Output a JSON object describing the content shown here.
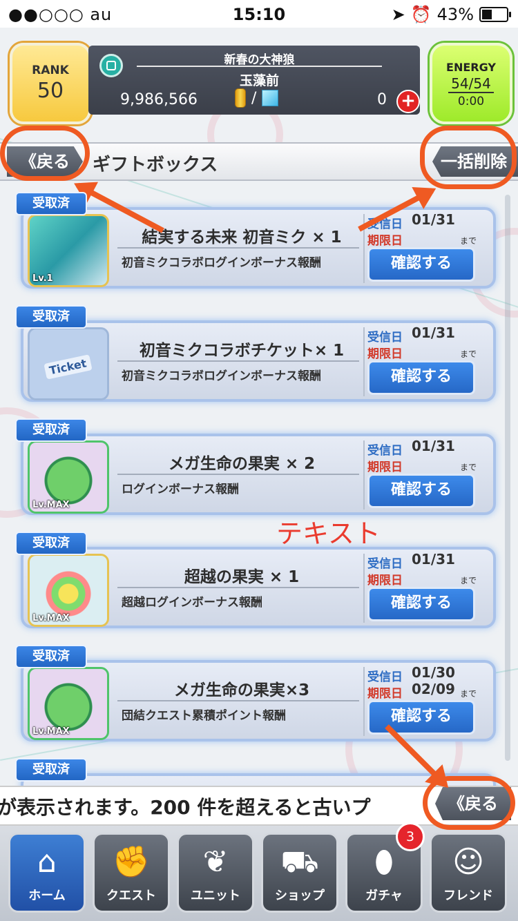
{
  "status_bar": {
    "carrier": "●●○○○ au",
    "time": "15:10",
    "battery": "43%"
  },
  "header": {
    "rank_label": "RANK",
    "rank_value": "50",
    "player_title": "新春の大神狼",
    "player_name": "玉藻前",
    "coins": "9,986,566",
    "currency_separator": "/",
    "gems": "0",
    "energy_label": "ENERGY",
    "energy_value": "54/54",
    "energy_timer": "0:00"
  },
  "titlebar": {
    "back_label": "《戻る",
    "title": "ギフトボックス",
    "delete_all_label": "一括削除"
  },
  "items": [
    {
      "tag": "受取済",
      "name": "結実する未来 初音ミク × 1",
      "desc": "初音ミクコラボログインボーナス報酬",
      "recv_label": "受信日",
      "recv_date": "01/31",
      "exp_label": "期限日",
      "exp_date": "",
      "until": "まで",
      "button": "確認する",
      "thumb_level": "Lv.1"
    },
    {
      "tag": "受取済",
      "name": "初音ミクコラボチケット× 1",
      "desc": "初音ミクコラボログインボーナス報酬",
      "recv_label": "受信日",
      "recv_date": "01/31",
      "exp_label": "期限日",
      "exp_date": "",
      "until": "まで",
      "button": "確認する",
      "thumb_level": "Ticket"
    },
    {
      "tag": "受取済",
      "name": "メガ生命の果実 × 2",
      "desc": "ログインボーナス報酬",
      "recv_label": "受信日",
      "recv_date": "01/31",
      "exp_label": "期限日",
      "exp_date": "",
      "until": "まで",
      "button": "確認する",
      "thumb_level": "Lv.MAX"
    },
    {
      "tag": "受取済",
      "name": "超越の果実 × 1",
      "desc": "超越ログインボーナス報酬",
      "recv_label": "受信日",
      "recv_date": "01/31",
      "exp_label": "期限日",
      "exp_date": "",
      "until": "まで",
      "button": "確認する",
      "thumb_level": "Lv.MAX"
    },
    {
      "tag": "受取済",
      "name": "メガ生命の果実×3",
      "desc": "団結クエスト累積ポイント報酬",
      "recv_label": "受信日",
      "recv_date": "01/30",
      "exp_label": "期限日",
      "exp_date": "02/09",
      "until": "まで",
      "button": "確認する",
      "thumb_level": "Lv.MAX"
    },
    {
      "tag": "受取済"
    }
  ],
  "annotation_text": "テキスト",
  "ticker": {
    "text": "が表示されます。200 件を超えると古いプ",
    "back_label": "《戻る"
  },
  "tabs": [
    {
      "label": "ホーム",
      "icon": "home-icon"
    },
    {
      "label": "クエスト",
      "icon": "handshake-icon"
    },
    {
      "label": "ユニット",
      "icon": "rabbit-icon"
    },
    {
      "label": "ショップ",
      "icon": "cart-icon"
    },
    {
      "label": "ガチャ",
      "icon": "egg-icon",
      "badge": "3"
    },
    {
      "label": "フレンド",
      "icon": "friends-icon"
    }
  ]
}
